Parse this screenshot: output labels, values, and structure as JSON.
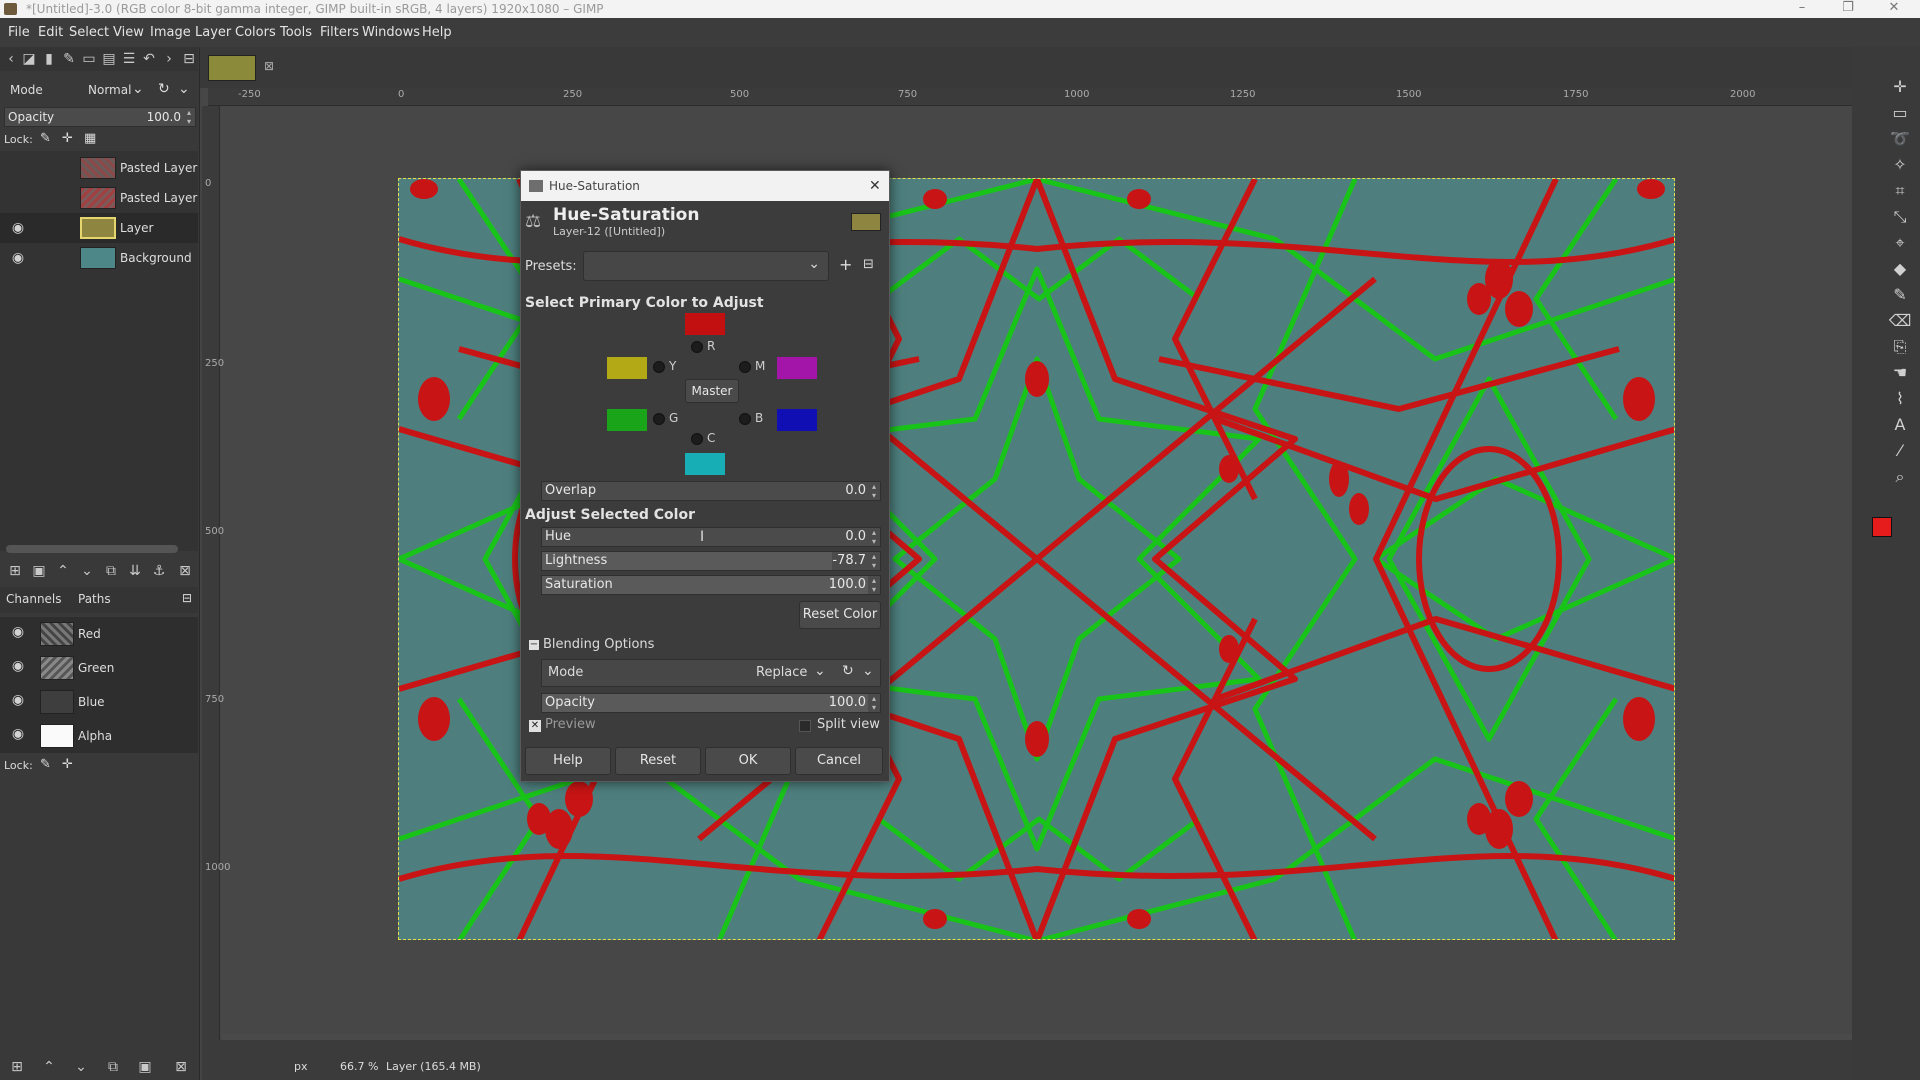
{
  "window": {
    "title": "*[Untitled]-3.0 (RGB color 8-bit gamma integer, GIMP built-in sRGB, 4 layers) 1920x1080 – GIMP"
  },
  "menu": [
    "File",
    "Edit",
    "Select",
    "View",
    "Image",
    "Layer",
    "Colors",
    "Tools",
    "Filters",
    "Windows",
    "Help"
  ],
  "layers_panel": {
    "mode_label": "Mode",
    "mode_value": "Normal",
    "opacity_label": "Opacity",
    "opacity_value": "100.0",
    "lock_label": "Lock:",
    "layers": [
      {
        "name": "Pasted Layer",
        "visible": false
      },
      {
        "name": "Pasted Layer",
        "visible": false
      },
      {
        "name": "Layer",
        "visible": true
      },
      {
        "name": "Background",
        "visible": true
      }
    ]
  },
  "channels_panel": {
    "tab_channels": "Channels",
    "tab_paths": "Paths",
    "channels": [
      "Red",
      "Green",
      "Blue",
      "Alpha"
    ],
    "lock_label": "Lock:"
  },
  "ruler": {
    "h_ticks": [
      "-250",
      "0",
      "250",
      "500",
      "750",
      "1000",
      "1250",
      "1500",
      "1750",
      "2000"
    ],
    "v_ticks": [
      "0",
      "250",
      "500",
      "750",
      "1000"
    ]
  },
  "dialog": {
    "window_title": "Hue-Saturation",
    "heading": "Hue-Saturation",
    "subheading": "Layer-12 ([Untitled])",
    "presets_label": "Presets:",
    "primary_heading": "Select Primary Color to Adjust",
    "radio_labels": {
      "r": "R",
      "y": "Y",
      "m": "M",
      "g": "G",
      "b": "B",
      "c": "C"
    },
    "master_button": "Master",
    "overlap": {
      "label": "Overlap",
      "value": "0.0"
    },
    "adjust_heading": "Adjust Selected Color",
    "hue": {
      "label": "Hue",
      "value": "0.0"
    },
    "lightness": {
      "label": "Lightness",
      "value": "-78.7"
    },
    "saturation": {
      "label": "Saturation",
      "value": "100.0"
    },
    "reset_color_button": "Reset Color",
    "blending_options": "Blending Options",
    "mode": {
      "label": "Mode",
      "value": "Replace"
    },
    "opacity": {
      "label": "Opacity",
      "value": "100.0"
    },
    "preview_label": "Preview",
    "split_view_label": "Split view",
    "help_button": "Help",
    "reset_button": "Reset",
    "ok_button": "OK",
    "cancel_button": "Cancel",
    "swatch_colors": {
      "red": "#c21010",
      "yellow": "#b3a916",
      "magenta": "#a314a8",
      "green": "#1aa41a",
      "blue": "#0f0fb3",
      "cyan": "#17aeb5"
    }
  },
  "status": {
    "unit": "px",
    "zoom": "66.7 %",
    "info": "Layer (165.4 MB)"
  },
  "colors": {
    "fg": "#e61c1c",
    "bg": "#35a8a1",
    "image_bg": "#4e7f7e",
    "line_red": "#c81414",
    "line_green": "#19c419"
  }
}
